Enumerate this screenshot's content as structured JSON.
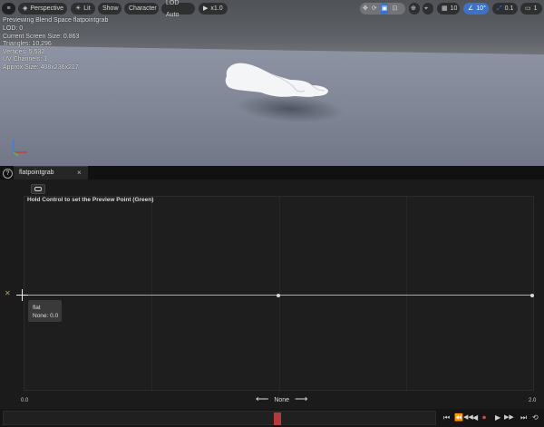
{
  "viewport": {
    "toolbar": {
      "menu_icon": "hamburger-icon",
      "perspective": "Perspective",
      "lit": "Lit",
      "show": "Show",
      "character": "Character",
      "lod": "LOD Auto",
      "play_speed": "x1.0",
      "grid_size": "10",
      "rotation_snap": "10°",
      "scale_snap": "0.1",
      "camera_speed": "1"
    },
    "info_lines": [
      "Previewing Blend Space flatpointgrab",
      "LOD: 0",
      "Current Screen Size: 0.863",
      "Triangles: 10,296",
      "Vertices: 5,532",
      "UV Channels: 1",
      "Approx Size: 408x236x217"
    ]
  },
  "tabs": [
    {
      "label": "flatpointgrab",
      "close": "×"
    }
  ],
  "editor": {
    "hint": "Hold Control to set the Preview Point (Green)",
    "tooltip": {
      "name": "flat",
      "value": "None: 0.0"
    },
    "x_axis": {
      "min": "0.0",
      "max": "2.0",
      "name": "None",
      "left_arrow": "⟵",
      "right_arrow": "⟶"
    },
    "axis_mark": "✕"
  },
  "timeline": {
    "controls": [
      "⏮",
      "⏪",
      "◀◀",
      "◀",
      "⏺",
      "▶",
      "▶▶",
      "⏭",
      "⟲"
    ]
  },
  "colors": {
    "accent_blue": "#3d72c9",
    "playhead": "#b53b3b",
    "sample_point": "#d8d8d8"
  }
}
